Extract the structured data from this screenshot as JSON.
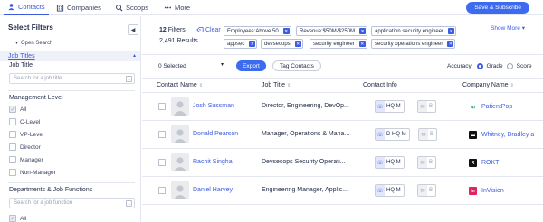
{
  "nav": {
    "tabs": [
      {
        "label": "Contacts",
        "icon": "contacts-icon",
        "active": true
      },
      {
        "label": "Companies",
        "icon": "companies-icon",
        "active": false
      },
      {
        "label": "Scoops",
        "icon": "scoops-icon",
        "active": false
      },
      {
        "label": "More",
        "icon": "more-dots-icon",
        "active": false
      }
    ],
    "save_label": "Save & Subscribe"
  },
  "sidebar": {
    "title": "Select Filters",
    "collapse_glyph": "◀",
    "open_search": "Open Search",
    "open_search_caret": "▾",
    "job_titles": {
      "section_label": "Job Titles",
      "chevron": "▴",
      "field_label": "Job Title",
      "placeholder": "Search for a job title",
      "go_glyph": "→"
    },
    "management_level": {
      "label": "Management Level",
      "options": [
        {
          "label": "All",
          "checked": true
        },
        {
          "label": "C-Level",
          "checked": false
        },
        {
          "label": "VP-Level",
          "checked": false
        },
        {
          "label": "Director",
          "checked": false
        },
        {
          "label": "Manager",
          "checked": false
        },
        {
          "label": "Non-Manager",
          "checked": false
        }
      ]
    },
    "departments": {
      "label": "Departments & Job Functions",
      "placeholder": "Search for a job function",
      "go_glyph": "→",
      "options": [
        {
          "label": "All",
          "checked": true
        }
      ]
    }
  },
  "filters": {
    "count": "12",
    "count_suffix": "Filters",
    "clear_label": "Clear",
    "results": "2,491 Results",
    "show_more": "Show More",
    "show_more_caret": "▾",
    "remove_glyph": "✕",
    "chips": [
      "Employees:Above 50",
      "Revenue:$50M-$250M",
      "application security engineer",
      "appsec",
      "devsecops",
      "security engineer",
      "security operations engineer"
    ]
  },
  "actions": {
    "selected_label": "0 Selected",
    "selected_caret": "▾",
    "export_label": "Export",
    "tag_label": "Tag Contacts",
    "accuracy_label": "Accuracy:",
    "accuracy_options": [
      {
        "label": "Grade",
        "selected": true
      },
      {
        "label": "Score",
        "selected": false
      }
    ]
  },
  "table": {
    "headers": [
      "Contact Name",
      "Job Title",
      "Contact Info",
      "Company Name"
    ],
    "sort_glyph": "⇕",
    "rows": [
      {
        "name": "Josh Sussman",
        "title": "Director, Engineering, DevOp...",
        "phone": "HQ M",
        "email": "B",
        "company": "PatientPop",
        "logo_text": "ꝏ",
        "logo_fg": "#1aa37a",
        "logo_bg": "#ffffff"
      },
      {
        "name": "Donald Pearson",
        "title": "Manager, Operations & Mana...",
        "phone": "D HQ M",
        "email": "B",
        "company": "Whitney, Bradley a",
        "logo_text": "▬",
        "logo_fg": "#ffffff",
        "logo_bg": "#111111"
      },
      {
        "name": "Rachit Singhal",
        "title": "Devsecops Security Operati...",
        "phone": "HQ M",
        "email": "B",
        "company": "ROKT",
        "logo_text": "R",
        "logo_fg": "#ffffff",
        "logo_bg": "#111111"
      },
      {
        "name": "Daniel Harvey",
        "title": "Engineering Manager, Applic...",
        "phone": "HQ M",
        "email": "B",
        "company": "InVision",
        "logo_text": "in",
        "logo_fg": "#ffffff",
        "logo_bg": "#e0245e"
      }
    ]
  }
}
